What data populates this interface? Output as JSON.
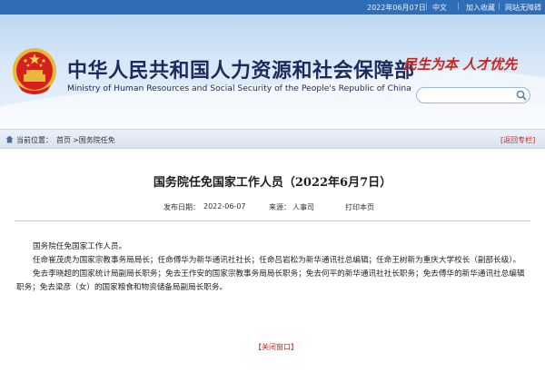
{
  "topbar": {
    "date": "2022年06月07日",
    "language": "中文",
    "separator": "|",
    "favorite": "加入收藏",
    "site_nav": "网站无障碍"
  },
  "header": {
    "title_cn": "中华人民共和国人力资源和社会保障部",
    "title_en": "Ministry of Human Resources and Social Security of the People's Republic of China",
    "slogan": "民生为本 人才优先",
    "search_placeholder": ""
  },
  "breadcrumb": {
    "label": "当前位置：",
    "home": "首页",
    "current": ">国务院任免",
    "back": "[返回专栏]"
  },
  "article": {
    "title": "国务院任免国家工作人员（2022年6月7日）",
    "date_label": "发布日期：",
    "date": "2022-06-07",
    "source_label": "来源：",
    "source": "人事司",
    "print": "打印本页",
    "paragraphs": [
      "国务院任免国家工作人员。",
      "任命崔茂虎为国家宗教事务局局长；任命傅华为新华通讯社社长；任命吕岩松为新华通讯社总编辑；任命王树新为重庆大学校长（副部长级）。",
      "免去李晓超的国家统计局副局长职务；免去王作安的国家宗教事务局局长职务；免去何平的新华通讯社社长职务；免去傅华的新华通讯社总编辑职务；免去梁彦（女）的国家粮食和物资储备局副局长职务。"
    ],
    "close_label": "【关闭窗口】"
  },
  "colors": {
    "topbar_bg": "#2f6db6",
    "title_navy": "#1f2a5c",
    "accent_red": "#c8251d"
  }
}
